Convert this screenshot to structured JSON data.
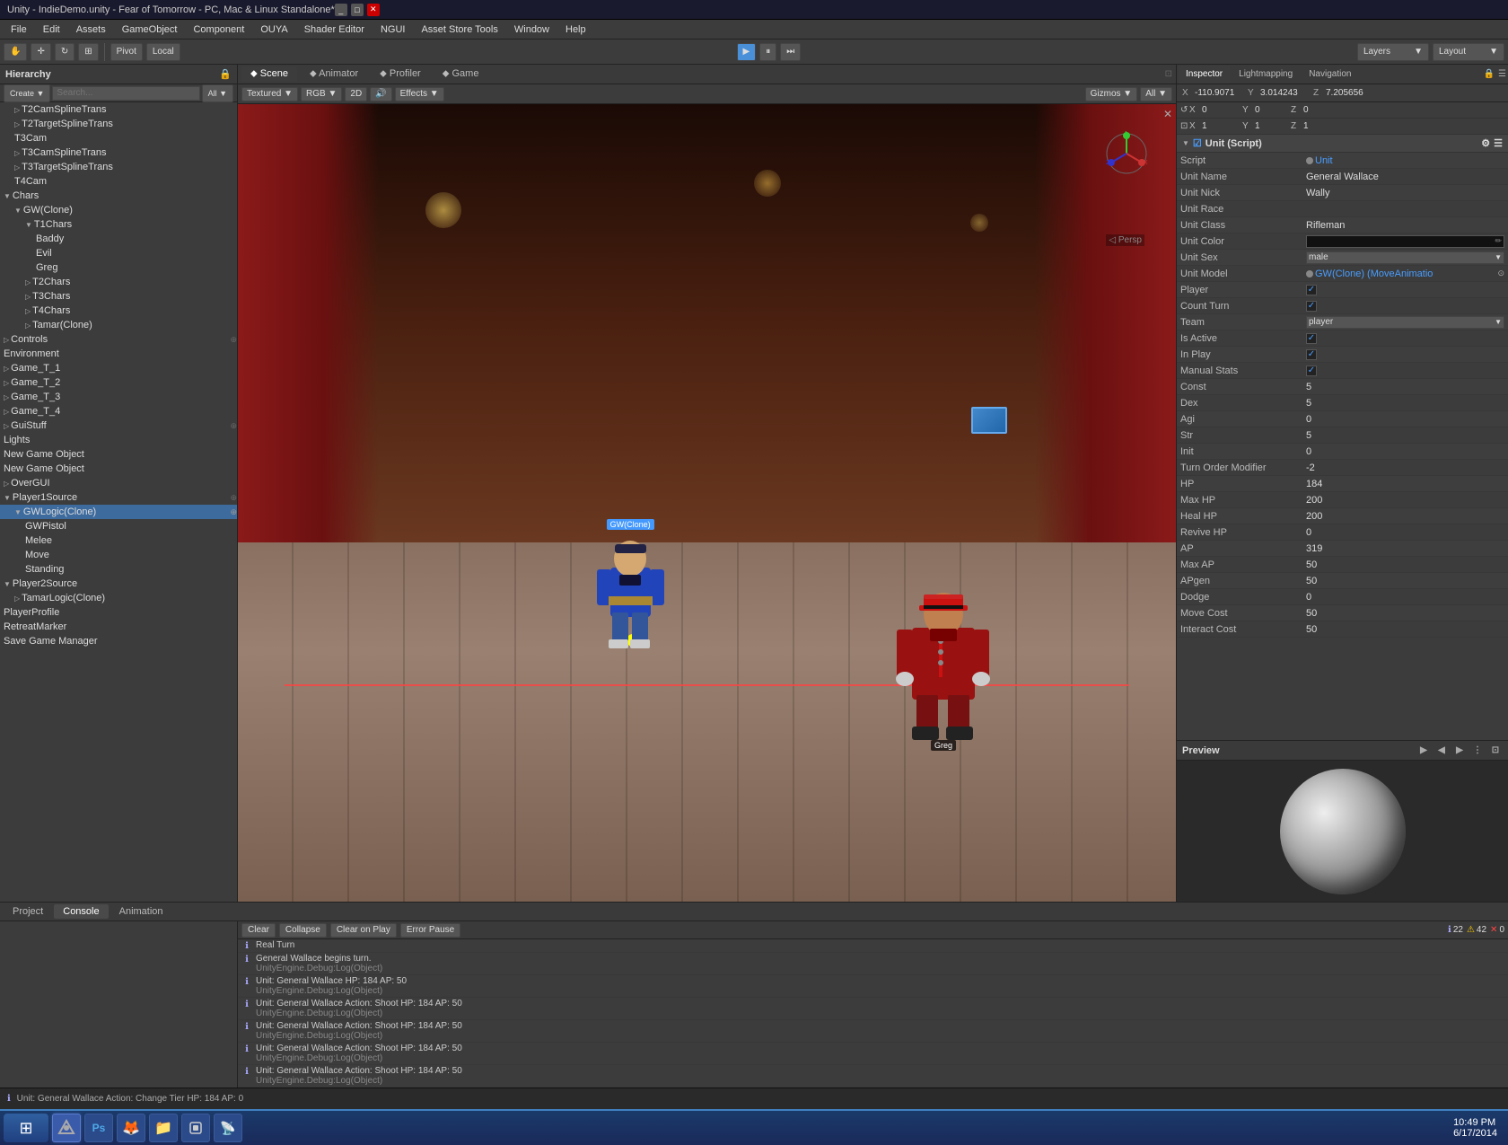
{
  "window": {
    "title": "Unity - IndieDemo.unity - Fear of Tomorrow - PC, Mac & Linux Standalone*",
    "controls": [
      "_",
      "□",
      "✕"
    ]
  },
  "menubar": {
    "items": [
      "File",
      "Edit",
      "Assets",
      "GameObject",
      "Component",
      "OUYA",
      "Shader Editor",
      "NGUI",
      "Asset Store Tools",
      "Window",
      "Help"
    ]
  },
  "toolbar": {
    "pivot_label": "Pivot",
    "local_label": "Local",
    "play_label": "▶",
    "pause_label": "⏸",
    "step_label": "⏭",
    "layers_label": "Layers",
    "layout_label": "Layout"
  },
  "hierarchy": {
    "title": "Hierarchy",
    "search_placeholder": "Search...",
    "create_label": "Create",
    "all_label": "All",
    "items": [
      {
        "label": "T2CamSplineTrans",
        "indent": 1
      },
      {
        "label": "T2TargetSplineTrans",
        "indent": 1
      },
      {
        "label": "T3Cam",
        "indent": 1
      },
      {
        "label": "T3CamSplineTrans",
        "indent": 1
      },
      {
        "label": "T3TargetSplineTrans",
        "indent": 1
      },
      {
        "label": "T4Cam",
        "indent": 1
      },
      {
        "label": "Chars",
        "indent": 0,
        "expanded": true
      },
      {
        "label": "GW(Clone)",
        "indent": 1,
        "expanded": true
      },
      {
        "label": "T1Chars",
        "indent": 2,
        "expanded": true
      },
      {
        "label": "Baddy",
        "indent": 3
      },
      {
        "label": "Evil",
        "indent": 3
      },
      {
        "label": "Greg",
        "indent": 3
      },
      {
        "label": "T2Chars",
        "indent": 2
      },
      {
        "label": "T3Chars",
        "indent": 2
      },
      {
        "label": "T4Chars",
        "indent": 2
      },
      {
        "label": "Tamar(Clone)",
        "indent": 2
      },
      {
        "label": "Controls",
        "indent": 0,
        "expanded": false
      },
      {
        "label": "Environment",
        "indent": 0
      },
      {
        "label": "Game_T_1",
        "indent": 0
      },
      {
        "label": "Game_T_2",
        "indent": 0
      },
      {
        "label": "Game_T_3",
        "indent": 0
      },
      {
        "label": "Game_T_4",
        "indent": 0
      },
      {
        "label": "GuiStuff",
        "indent": 0
      },
      {
        "label": "Lights",
        "indent": 0
      },
      {
        "label": "New Game Object",
        "indent": 0
      },
      {
        "label": "New Game Object",
        "indent": 0
      },
      {
        "label": "OverGUI",
        "indent": 0
      },
      {
        "label": "Player1Source",
        "indent": 0,
        "expanded": true
      },
      {
        "label": "GWLogic(Clone)",
        "indent": 1,
        "expanded": true,
        "selected": true
      },
      {
        "label": "GWPistol",
        "indent": 2
      },
      {
        "label": "Melee",
        "indent": 2
      },
      {
        "label": "Move",
        "indent": 2
      },
      {
        "label": "Standing",
        "indent": 2
      },
      {
        "label": "Player2Source",
        "indent": 0,
        "expanded": true
      },
      {
        "label": "TamarLogic(Clone)",
        "indent": 1
      },
      {
        "label": "PlayerProfile",
        "indent": 0
      },
      {
        "label": "RetreatMarker",
        "indent": 0
      },
      {
        "label": "Save Game Manager",
        "indent": 0
      }
    ]
  },
  "view_tabs": {
    "tabs": [
      "Scene",
      "Animator",
      "Profiler",
      "Game"
    ]
  },
  "view_toolbar": {
    "textured": "Textured",
    "rgb": "RGB",
    "twod": "2D",
    "effects": "Effects",
    "gizmos": "Gizmos",
    "all": "All"
  },
  "inspector": {
    "title": "Inspector",
    "tabs": [
      "Inspector",
      "Lightmapping",
      "Navigation"
    ],
    "position": {
      "x_label": "X",
      "x_val": "-110.9071",
      "y_label": "Y",
      "y_val": "3.014243",
      "z_label": "Z",
      "z_val": "7.205656"
    },
    "transform": {
      "x_val": "0",
      "y_val": "0",
      "z_val": "0",
      "sx_val": "1",
      "sy_val": "1",
      "sz_val": "1"
    },
    "unit_script": {
      "section": "Unit (Script)",
      "script_label": "Script",
      "script_value": "Unit",
      "unit_name_label": "Unit Name",
      "unit_name_value": "General Wallace",
      "unit_nick_label": "Unit Nick",
      "unit_nick_value": "Wally",
      "unit_race_label": "Unit Race",
      "unit_race_value": "",
      "unit_class_label": "Unit Class",
      "unit_class_value": "Rifleman",
      "unit_color_label": "Unit Color",
      "unit_color_value": "",
      "unit_sex_label": "Unit Sex",
      "unit_sex_value": "male",
      "unit_model_label": "Unit Model",
      "unit_model_value": "GW(Clone) (MoveAnimatio",
      "player_label": "Player",
      "player_checked": true,
      "count_turn_label": "Count Turn",
      "count_turn_checked": true,
      "team_label": "Team",
      "team_value": "player",
      "is_active_label": "Is Active",
      "is_active_checked": true,
      "in_play_label": "In Play",
      "in_play_checked": true,
      "manual_stats_label": "Manual Stats",
      "manual_stats_checked": true,
      "const_label": "Const",
      "const_value": "5",
      "dex_label": "Dex",
      "dex_value": "5",
      "agi_label": "Agi",
      "agi_value": "0",
      "str_label": "Str",
      "str_value": "5",
      "init_label": "Init",
      "init_value": "0",
      "turn_order_label": "Turn Order Modifier",
      "turn_order_value": "-2",
      "hp_label": "HP",
      "hp_value": "184",
      "max_hp_label": "Max HP",
      "max_hp_value": "200",
      "heal_hp_label": "Heal HP",
      "heal_hp_value": "200",
      "revive_hp_label": "Revive HP",
      "revive_hp_value": "0",
      "ap_label": "AP",
      "ap_value": "319",
      "max_ap_label": "Max AP",
      "max_ap_value": "50",
      "apgen_label": "APgen",
      "apgen_value": "50",
      "dodge_label": "Dodge",
      "dodge_value": "0",
      "move_cost_label": "Move Cost",
      "move_cost_value": "50",
      "interact_cost_label": "Interact Cost",
      "interact_cost_value": "50"
    }
  },
  "preview": {
    "title": "Preview"
  },
  "bottom_tabs": {
    "tabs": [
      "Project",
      "Console",
      "Animation"
    ],
    "active": "Console"
  },
  "console": {
    "buttons": [
      "Clear",
      "Collapse",
      "Clear on Play",
      "Error Pause"
    ],
    "counts": {
      "info": "22",
      "warn": "42",
      "error": "0"
    },
    "logs": [
      {
        "type": "info",
        "text": "Real Turn",
        "sub": ""
      },
      {
        "type": "info",
        "text": "General Wallace begins turn.",
        "sub": "UnityEngine.Debug:Log(Object)"
      },
      {
        "type": "info",
        "text": "Unit: General Wallace  HP: 184   AP: 50",
        "sub": "UnityEngine.Debug:Log(Object)"
      },
      {
        "type": "info",
        "text": "Unit: General Wallace  Action: Shoot   HP: 184   AP: 50",
        "sub": "UnityEngine.Debug:Log(Object)"
      },
      {
        "type": "info",
        "text": "Unit: General Wallace  Action: Shoot   HP: 184   AP: 50",
        "sub": "UnityEngine.Debug:Log(Object)"
      },
      {
        "type": "info",
        "text": "Unit: General Wallace  Action: Shoot   HP: 184   AP: 50",
        "sub": "UnityEngine.Debug:Log(Object)"
      },
      {
        "type": "info",
        "text": "Unit: General Wallace  Action: Shoot   HP: 184   AP: 50",
        "sub": "UnityEngine.Debug:Log(Object)"
      }
    ]
  },
  "status_bar": {
    "message": "Unit: General Wallace  Action: Change Tier  HP: 184  AP: 0"
  },
  "taskbar": {
    "time": "10:49 PM",
    "date": "6/17/2014",
    "apps": [
      "⊞",
      "PS",
      "🦊",
      "📁",
      "🎮",
      "🔲",
      "📡"
    ]
  }
}
